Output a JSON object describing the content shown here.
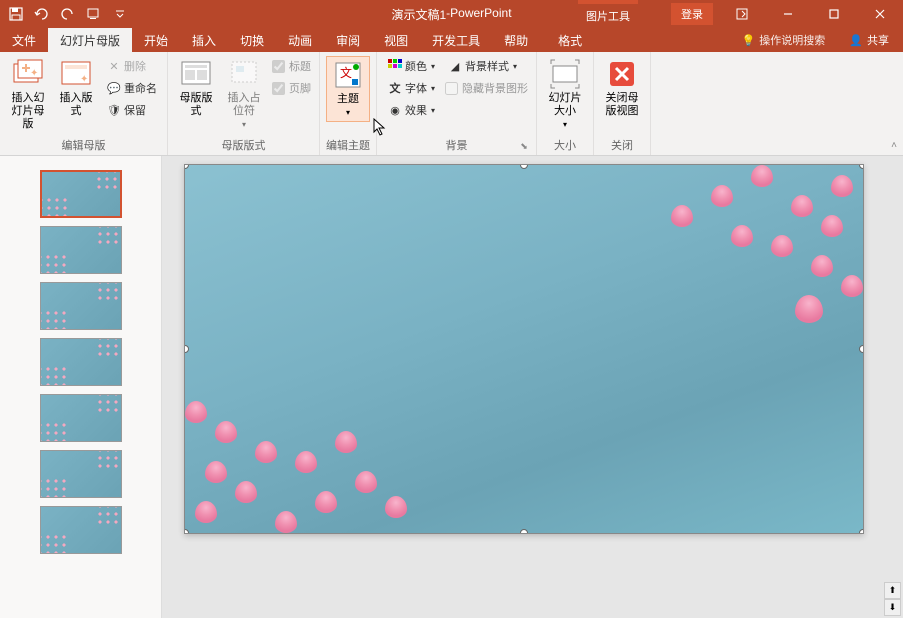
{
  "title": {
    "doc": "演示文稿1",
    "sep": " - ",
    "app": "PowerPoint"
  },
  "context_tab": "图片工具",
  "account": "登录",
  "tabs": {
    "file": "文件",
    "slide_master": "幻灯片母版",
    "home": "开始",
    "insert": "插入",
    "transitions": "切换",
    "animations": "动画",
    "review": "审阅",
    "view": "视图",
    "developer": "开发工具",
    "help": "帮助",
    "format": "格式",
    "tell_me": "操作说明搜索",
    "share": "共享"
  },
  "ribbon": {
    "edit_master": {
      "insert_slide_master": "插入幻灯片母版",
      "insert_layout": "插入版式",
      "delete": "删除",
      "rename": "重命名",
      "preserve": "保留",
      "label": "编辑母版"
    },
    "master_layout": {
      "master_layout": "母版版式",
      "insert_placeholder": "插入占位符",
      "title": "标题",
      "footers": "页脚",
      "label": "母版版式"
    },
    "edit_theme": {
      "themes": "主题",
      "label": "编辑主题"
    },
    "background": {
      "colors": "颜色",
      "fonts": "字体",
      "effects": "效果",
      "bg_styles": "背景样式",
      "hide_bg": "隐藏背景图形",
      "label": "背景"
    },
    "size": {
      "slide_size": "幻灯片大小",
      "label": "大小"
    },
    "close": {
      "close_master": "关闭母版视图",
      "label": "关闭"
    }
  }
}
